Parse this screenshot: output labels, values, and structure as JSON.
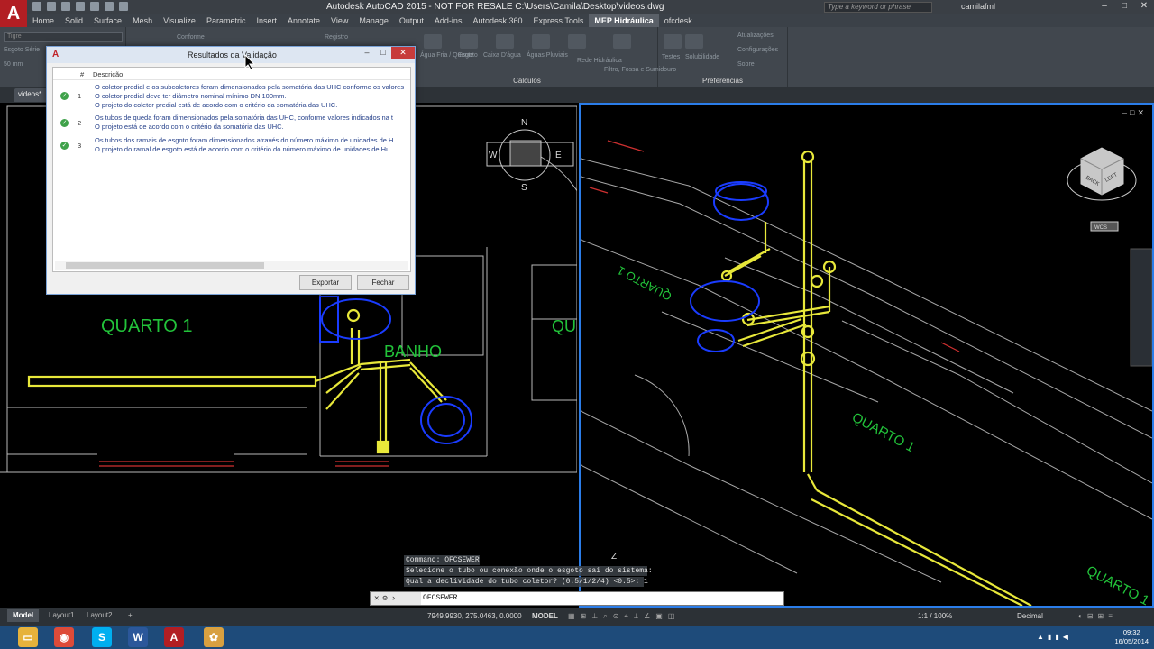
{
  "titlebar": {
    "logo": "A",
    "title": "Autodesk AutoCAD 2015 - NOT FOR RESALE    C:\\Users\\Camila\\Desktop\\videos.dwg",
    "search_placeholder": "Type a keyword or phrase",
    "user": "camilafml"
  },
  "tabs": [
    "Home",
    "Solid",
    "Surface",
    "Mesh",
    "Visualize",
    "Parametric",
    "Insert",
    "Annotate",
    "View",
    "Manage",
    "Output",
    "Add-ins",
    "Autodesk 360",
    "Express Tools",
    "MEP Hidráulica",
    "ofcdesk"
  ],
  "active_tab": "MEP Hidráulica",
  "ribbon": {
    "layer_value": "Tigre",
    "layer_value2": "Esgoto Série",
    "size_value": "50 mm",
    "buttons_left": [
      "Conforme",
      "Registro"
    ],
    "calc_buttons": [
      "Água Fria / Quente",
      "Esgoto",
      "Caixa D'água",
      "Águas Pluviais",
      "Rede Hidráulica",
      "Filtro, Fossa e Sumidouro"
    ],
    "calc_label": "Cálculos",
    "pref_buttons": [
      "Testes",
      "Solubilidade",
      "Atualizações",
      "Configurações",
      "Sobre"
    ],
    "pref_label": "Preferências"
  },
  "doc_tab": "videos*",
  "drawing_labels": {
    "quarto1_left": "QUARTO 1",
    "banho": "BANHO",
    "quarto_partial": "QU",
    "compass": [
      "N",
      "S",
      "E",
      "W"
    ],
    "wcs": "WCS",
    "quarto1_right": "QUARTO 1",
    "quarto1_right2": "QUARTO 1",
    "viewcube_faces": [
      "BACK",
      "LEFT"
    ],
    "ucs_axis": "Z"
  },
  "dialog": {
    "logo": "A",
    "title": "Resultados da Validação",
    "col_num": "#",
    "col_desc": "Descrição",
    "rows": [
      {
        "num": "1",
        "lines": [
          "O coletor predial e os subcoletores foram dimensionados pela somatória das UHC conforme os valores",
          "O coletor predial deve ter diâmetro nominal mínimo DN 100mm.",
          "O projeto do coletor predial está de acordo com o critério da somatória das UHC."
        ]
      },
      {
        "num": "2",
        "lines": [
          "Os tubos de queda foram dimensionados pela somatória das UHC, conforme valores indicados na t",
          "O projeto está de acordo com o critério da somatória das UHC."
        ]
      },
      {
        "num": "3",
        "lines": [
          "Os tubos dos ramais de esgoto foram dimensionados através do número máximo de unidades de H",
          "O projeto do ramal de esgoto está de acordo com o critério do número máximo de unidades de Hu"
        ]
      }
    ],
    "export_label": "Exportar",
    "close_label": "Fechar"
  },
  "command": {
    "history": [
      "Command: OFCSEWER",
      "Selecione o tubo ou conexão onde o esgoto sai do sistema:",
      "Qual a declividade do tubo coletor? (0.5/1/2/4) <0.5>: 1"
    ],
    "current": "OFCSEWER"
  },
  "layout_tabs": [
    "Model",
    "Layout1",
    "Layout2"
  ],
  "status": {
    "coords": "7949.9930, 275.0463, 0.0000",
    "mode": "MODEL",
    "scale": "1:1 / 100%",
    "units": "Decimal"
  },
  "clock": {
    "time": "09:32",
    "date": "16/05/2014"
  },
  "colors": {
    "accent": "#2b7de9",
    "pipe": "#e8e83a",
    "fixture": "#1a3cff",
    "label": "#22c33a"
  }
}
